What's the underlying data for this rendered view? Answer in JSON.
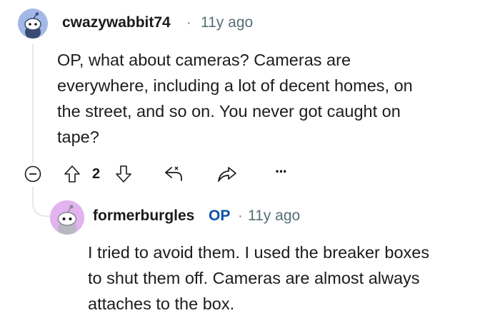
{
  "comment": {
    "username": "cwazywabbit74",
    "separator": "·",
    "time": "11y ago",
    "avatar_color": "#a3b8e6",
    "lines": [
      "OP, what about cameras? Cameras are",
      "everywhere, including a lot of decent homes, on",
      "the street, and so on. You never got caught on",
      "tape?"
    ],
    "vote_count": "2",
    "more_label": "···"
  },
  "reply": {
    "username": "formerburgles",
    "op_badge": "OP",
    "separator": "·",
    "time": "11y ago",
    "avatar_color": "#e2b3ee",
    "lines": [
      "I tried to avoid them. I used the breaker boxes",
      "to shut them off. Cameras are almost always",
      "attaches to the box."
    ]
  },
  "colors": {
    "thread_line": "#e5e7ea",
    "op_badge": "#0e53a7",
    "meta_gray": "#576f76"
  }
}
